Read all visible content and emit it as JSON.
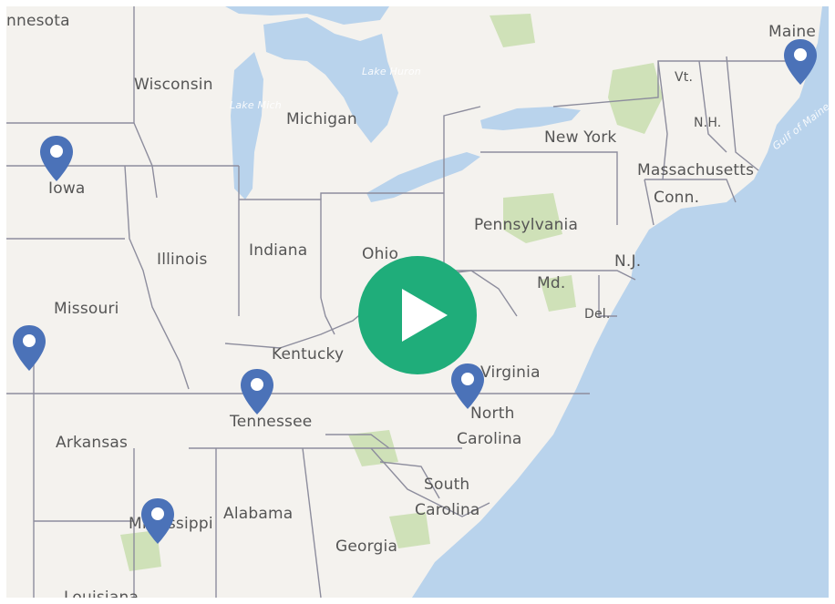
{
  "map": {
    "colors": {
      "land": "#f4f2ee",
      "water": "#b9d3ec",
      "forest": "#cfe1b8",
      "border": "#8d8d9d",
      "pin": "#4b72b8",
      "play_button": "#1fad7a"
    },
    "labels": {
      "minnesota": "nnesota",
      "wisconsin": "Wisconsin",
      "michigan": "Michigan",
      "lake_michigan": "Lake Mich",
      "lake_huron": "Lake Huron",
      "iowa": "Iowa",
      "illinois": "Illinois",
      "indiana": "Indiana",
      "ohio": "Ohio",
      "pennsylvania": "Pennsylvania",
      "new_york": "New York",
      "vermont": "Vt.",
      "new_hampshire": "N.H.",
      "maine": "Maine",
      "gulf_of_maine": "Gulf of Maine",
      "massachusetts": "Massachusetts",
      "connecticut": "Conn.",
      "new_jersey": "N.J.",
      "maryland": "Md.",
      "delaware": "Del.",
      "missouri": "Missouri",
      "kentucky": "Kentucky",
      "virginia": "Virginia",
      "tennessee": "Tennessee",
      "north_carolina_1": "North",
      "north_carolina_2": "Carolina",
      "arkansas": "Arkansas",
      "south_carolina_1": "South",
      "south_carolina_2": "Carolina",
      "mississippi": "Mississippi",
      "alabama": "Alabama",
      "georgia": "Georgia",
      "louisiana": "Louisiana"
    },
    "markers": [
      "iowa-pin",
      "missouri-pin",
      "tennessee-pin",
      "north-carolina-pin",
      "mississippi-pin",
      "maine-pin"
    ],
    "play_button_icon": "play-icon"
  }
}
